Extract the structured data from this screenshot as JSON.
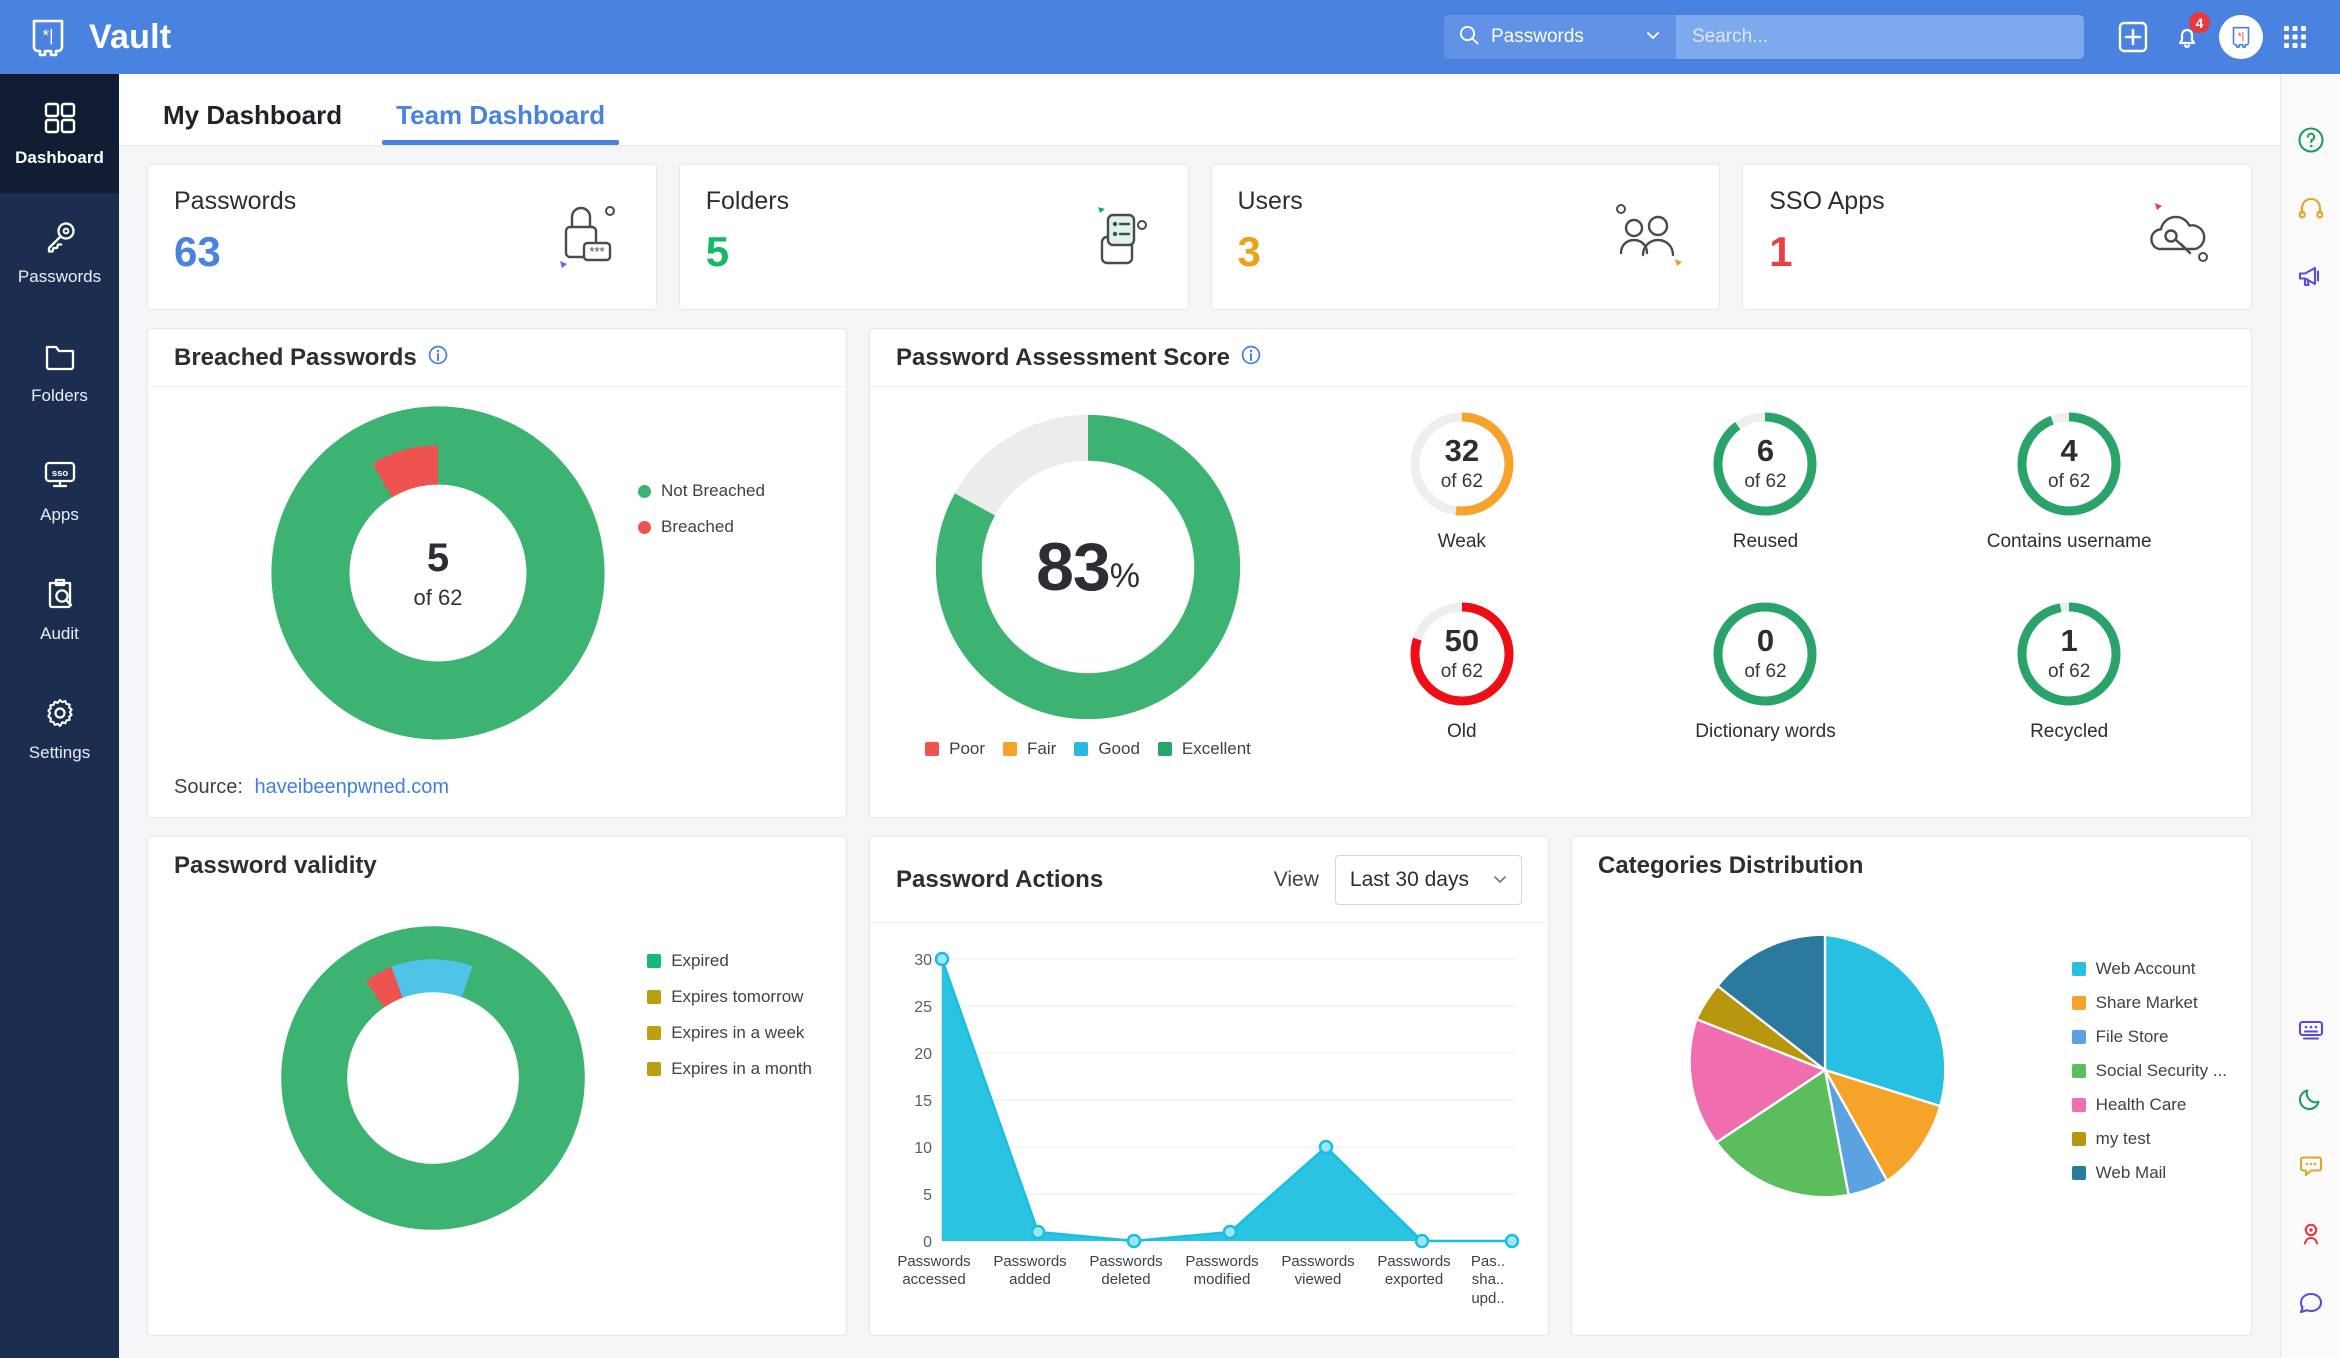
{
  "app": {
    "title": "Vault",
    "logo_icon": "vault-logo-icon"
  },
  "header": {
    "search_category": "Passwords",
    "search_placeholder": "Search...",
    "search_value": "",
    "search_icon": "search-icon",
    "category_chevron_icon": "chevron-down-icon",
    "add_icon": "plus-icon",
    "notification_icon": "bell-icon",
    "notification_count": "4",
    "profile_icon": "vault-avatar-icon",
    "apps_grid_icon": "grid-apps-icon",
    "accent": "#4a82e0"
  },
  "sidebar": {
    "items": [
      {
        "label": "Dashboard",
        "icon": "dashboard-grid-icon",
        "active": true
      },
      {
        "label": "Passwords",
        "icon": "key-icon",
        "active": false
      },
      {
        "label": "Folders",
        "icon": "folder-icon",
        "active": false
      },
      {
        "label": "Apps",
        "icon": "sso-monitor-icon",
        "active": false
      },
      {
        "label": "Audit",
        "icon": "clipboard-search-icon",
        "active": false
      },
      {
        "label": "Settings",
        "icon": "gear-icon",
        "active": false
      }
    ]
  },
  "right_rail": {
    "items": [
      {
        "icon": "help-question-icon",
        "color": "#1c9e62"
      },
      {
        "icon": "headset-support-icon",
        "color": "#e0a62b"
      },
      {
        "icon": "megaphone-announcement-icon",
        "color": "#5a4bdb"
      },
      {
        "icon": "keyboard-icon",
        "color": "#5a4bdb"
      },
      {
        "icon": "moon-dark-mode-icon",
        "color": "#1c9e62"
      },
      {
        "icon": "chat-bubble-icon",
        "color": "#e0a62b"
      },
      {
        "icon": "location-pin-icon",
        "color": "#e8373d"
      },
      {
        "icon": "chat-support-icon",
        "color": "#5a4bdb"
      }
    ]
  },
  "tabs": [
    {
      "label": "My Dashboard",
      "active": false
    },
    {
      "label": "Team Dashboard",
      "active": true
    }
  ],
  "stats": [
    {
      "title": "Passwords",
      "value": "63",
      "color": "#4a82e0",
      "icon": "lock-asterisk-icon"
    },
    {
      "title": "Folders",
      "value": "5",
      "color": "#14b866",
      "icon": "folder-list-icon"
    },
    {
      "title": "Users",
      "value": "3",
      "color": "#e8a416",
      "icon": "users-group-icon"
    },
    {
      "title": "SSO Apps",
      "value": "1",
      "color": "#ef3d47",
      "icon": "cloud-key-icon"
    }
  ],
  "breached": {
    "title": "Breached Passwords",
    "info_icon": "info-icon",
    "center_value": "5",
    "center_sub": "of 62",
    "source_label": "Source:",
    "source_link": "haveibeenpwned.com"
  },
  "assessment": {
    "title": "Password Assessment Score",
    "info_icon": "info-icon",
    "score": "83",
    "score_unit": "%",
    "metrics": [
      {
        "value": "32",
        "sub": "of 62",
        "label": "Weak",
        "color": "#f5a32a",
        "pct": 52
      },
      {
        "value": "6",
        "sub": "of 62",
        "label": "Reused",
        "color": "#29a36a",
        "pct": 90
      },
      {
        "value": "4",
        "sub": "of 62",
        "label": "Contains username",
        "color": "#29a36a",
        "pct": 94
      },
      {
        "value": "50",
        "sub": "of 62",
        "label": "Old",
        "color": "#ee0f16",
        "pct": 80
      },
      {
        "value": "0",
        "sub": "of 62",
        "label": "Dictionary words",
        "color": "#29a36a",
        "pct": 100
      },
      {
        "value": "1",
        "sub": "of 62",
        "label": "Recycled",
        "color": "#29a36a",
        "pct": 97
      }
    ]
  },
  "validity": {
    "title": "Password validity"
  },
  "password_actions": {
    "title": "Password Actions",
    "view_label": "View",
    "range_value": "Last 30 days",
    "chevron_icon": "chevron-down-icon"
  },
  "categories": {
    "title": "Categories Distribution"
  },
  "chart_data": [
    {
      "type": "pie",
      "name": "breached-passwords-donut",
      "title": "Breached Passwords",
      "labels": [
        "Not Breached",
        "Breached"
      ],
      "values": [
        57,
        5
      ],
      "colors": [
        "#3cb371",
        "#ef5350"
      ],
      "legend_position": "right",
      "center_label": "5",
      "center_sub": "of 62"
    },
    {
      "type": "pie",
      "name": "password-assessment-donut",
      "title": "Password Assessment Score",
      "labels": [
        "Poor",
        "Fair",
        "Good",
        "Excellent"
      ],
      "legend_colors": [
        "#ef5350",
        "#f5a32a",
        "#2bb8e0",
        "#29a36a"
      ],
      "values": [
        83,
        17
      ],
      "colors": [
        "#3cb371",
        "#ececec"
      ],
      "legend_position": "bottom",
      "center_label": "83%"
    },
    {
      "type": "pie",
      "name": "password-validity-donut",
      "title": "Password validity",
      "labels": [
        "Expired",
        "Expires tomorrow",
        "Expires in a week",
        "Expires in a month"
      ],
      "colors": [
        "#17b978",
        "#b8a00e",
        "#b8a00e",
        "#b8a00e"
      ],
      "values": [
        75,
        6,
        5,
        14
      ],
      "slice_colors": [
        "#3cb371",
        "#ef5350",
        "#4fc3e8",
        "#3cb371"
      ],
      "legend_position": "top-right"
    },
    {
      "type": "area",
      "name": "password-actions-area",
      "title": "Password Actions",
      "categories": [
        "Passwords accessed",
        "Passwords added",
        "Passwords deleted",
        "Passwords modified",
        "Passwords viewed",
        "Passwords exported",
        "Pas.. sha.. upd.."
      ],
      "values": [
        30,
        1,
        0,
        1,
        10,
        0,
        0
      ],
      "ylim": [
        0,
        32
      ],
      "yticks": [
        0,
        5,
        10,
        15,
        20,
        25,
        30
      ],
      "ylabel": "",
      "xlabel": "",
      "grid": true,
      "series_color": "#18bfe0"
    },
    {
      "type": "pie",
      "name": "categories-distribution-pie",
      "title": "Categories Distribution",
      "labels": [
        "Web Account",
        "Share Market",
        "File Store",
        "Social Security ...",
        "Health Care",
        "my test",
        "Web Mail"
      ],
      "colors": [
        "#28c0e0",
        "#f5a32a",
        "#5ba3e0",
        "#5cbd5c",
        "#f06eb0",
        "#b8960e",
        "#2b7a9e"
      ],
      "values": [
        30,
        13,
        6,
        16,
        15,
        5,
        15
      ],
      "legend_position": "right"
    }
  ]
}
